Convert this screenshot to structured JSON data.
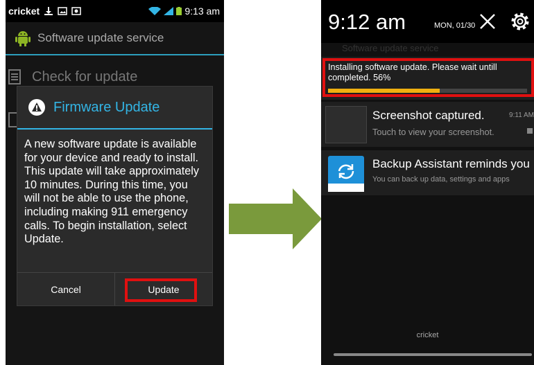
{
  "left_phone": {
    "status": {
      "carrier": "cricket",
      "time": "9:13 am"
    },
    "app_title": "Software update service",
    "background_items": [
      "Check for update"
    ],
    "dialog": {
      "title": "Firmware Update",
      "message": "A new software update is available for your device and ready to install. This update will take approximately 10 minutes. During this time, you will not be able to use the phone, including making 911 emergency calls. To begin installation, select Update.",
      "cancel_label": "Cancel",
      "update_label": "Update"
    }
  },
  "right_phone": {
    "time": "9:12 am",
    "date": "MON, 01/30",
    "faded_text": "Software update service",
    "progress": {
      "text": "Installing software update. Please wait untill completed.  56%",
      "percent": 56
    },
    "notifications": [
      {
        "title": "Screenshot captured.",
        "subtitle": "Touch to view your screenshot.",
        "time": "9:11 AM"
      },
      {
        "title": "Backup Assistant reminds you",
        "subtitle": "You can back up data, settings and apps"
      }
    ],
    "carrier_footer": "cricket"
  },
  "colors": {
    "accent": "#33b5e5",
    "highlight": "#e01010",
    "progress": "#f0b010",
    "arrow": "#7a9a3c"
  }
}
